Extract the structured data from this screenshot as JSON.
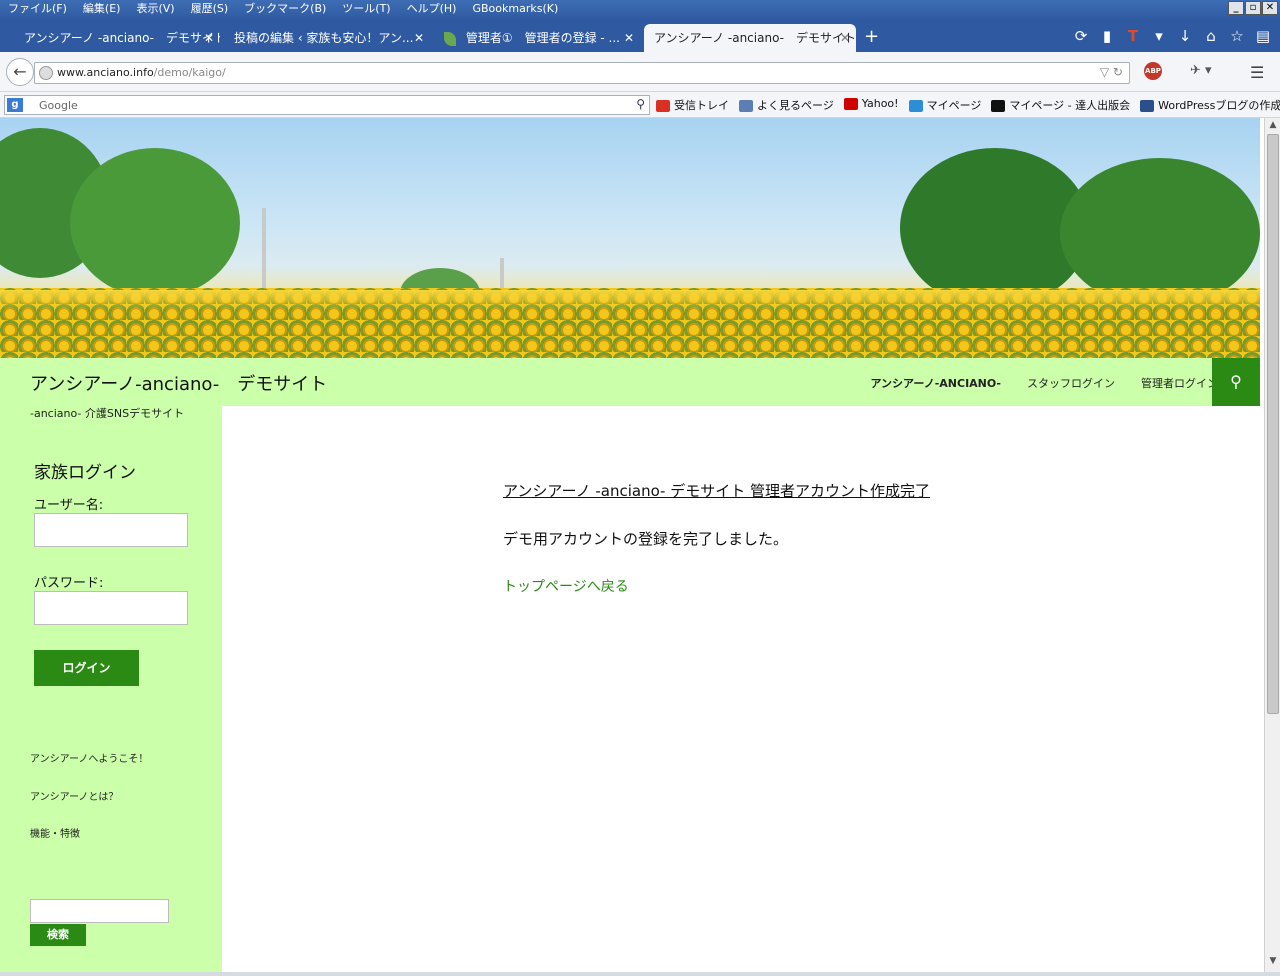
{
  "menubar": {
    "items": [
      "ファイル(F)",
      "編集(E)",
      "表示(V)",
      "履歴(S)",
      "ブックマーク(B)",
      "ツール(T)",
      "ヘルプ(H)",
      "GBookmarks(K)"
    ]
  },
  "tabs": [
    {
      "label": "アンシアーノ -anciano-　デモサイト..."
    },
    {
      "label": "投稿の編集 ‹ 家族も安心！アン..."
    },
    {
      "label": "管理者①　管理者の登録 - ..."
    },
    {
      "label": "アンシアーノ -anciano-　デモサイト..."
    }
  ],
  "navbar": {
    "url_domain": "www.anciano.info",
    "url_path": "/demo/kaigo/"
  },
  "search": {
    "placeholder": "Google"
  },
  "bookmarks": [
    {
      "label": "受信トレイ",
      "color": "#d93025"
    },
    {
      "label": "よく見るページ",
      "color": "#5b7fb5"
    },
    {
      "label": "Yahoo!",
      "color": "#d00000"
    },
    {
      "label": "マイページ",
      "color": "#2c8fd6"
    },
    {
      "label": "マイページ - 達人出版会",
      "color": "#111111"
    },
    {
      "label": "WordPressブログの作成...",
      "color": "#2a4f8a"
    }
  ],
  "site": {
    "title": "アンシアーノ-anciano-　デモサイト",
    "tagline": "-anciano- 介護SNSデモサイト",
    "nav": [
      "アンシアーノ-ANCIANO-",
      "スタッフログイン",
      "管理者ログイン"
    ]
  },
  "sidebar": {
    "login_heading": "家族ログイン",
    "username_label": "ユーザー名:",
    "password_label": "パスワード:",
    "login_button": "ログイン",
    "links": [
      "アンシアーノへようこそ！",
      "アンシアーノとは？",
      "機能・特徴"
    ],
    "search_button": "検索"
  },
  "main": {
    "title": "アンシアーノ -anciano- デモサイト 管理者アカウント作成完了",
    "message": "デモ用アカウントの登録を完了しました。",
    "back_link": "トップページへ戻る"
  },
  "colors": {
    "accent": "#2a8a14",
    "header_bg": "#ccffaa",
    "chrome_blue": "#2f5aa1"
  }
}
